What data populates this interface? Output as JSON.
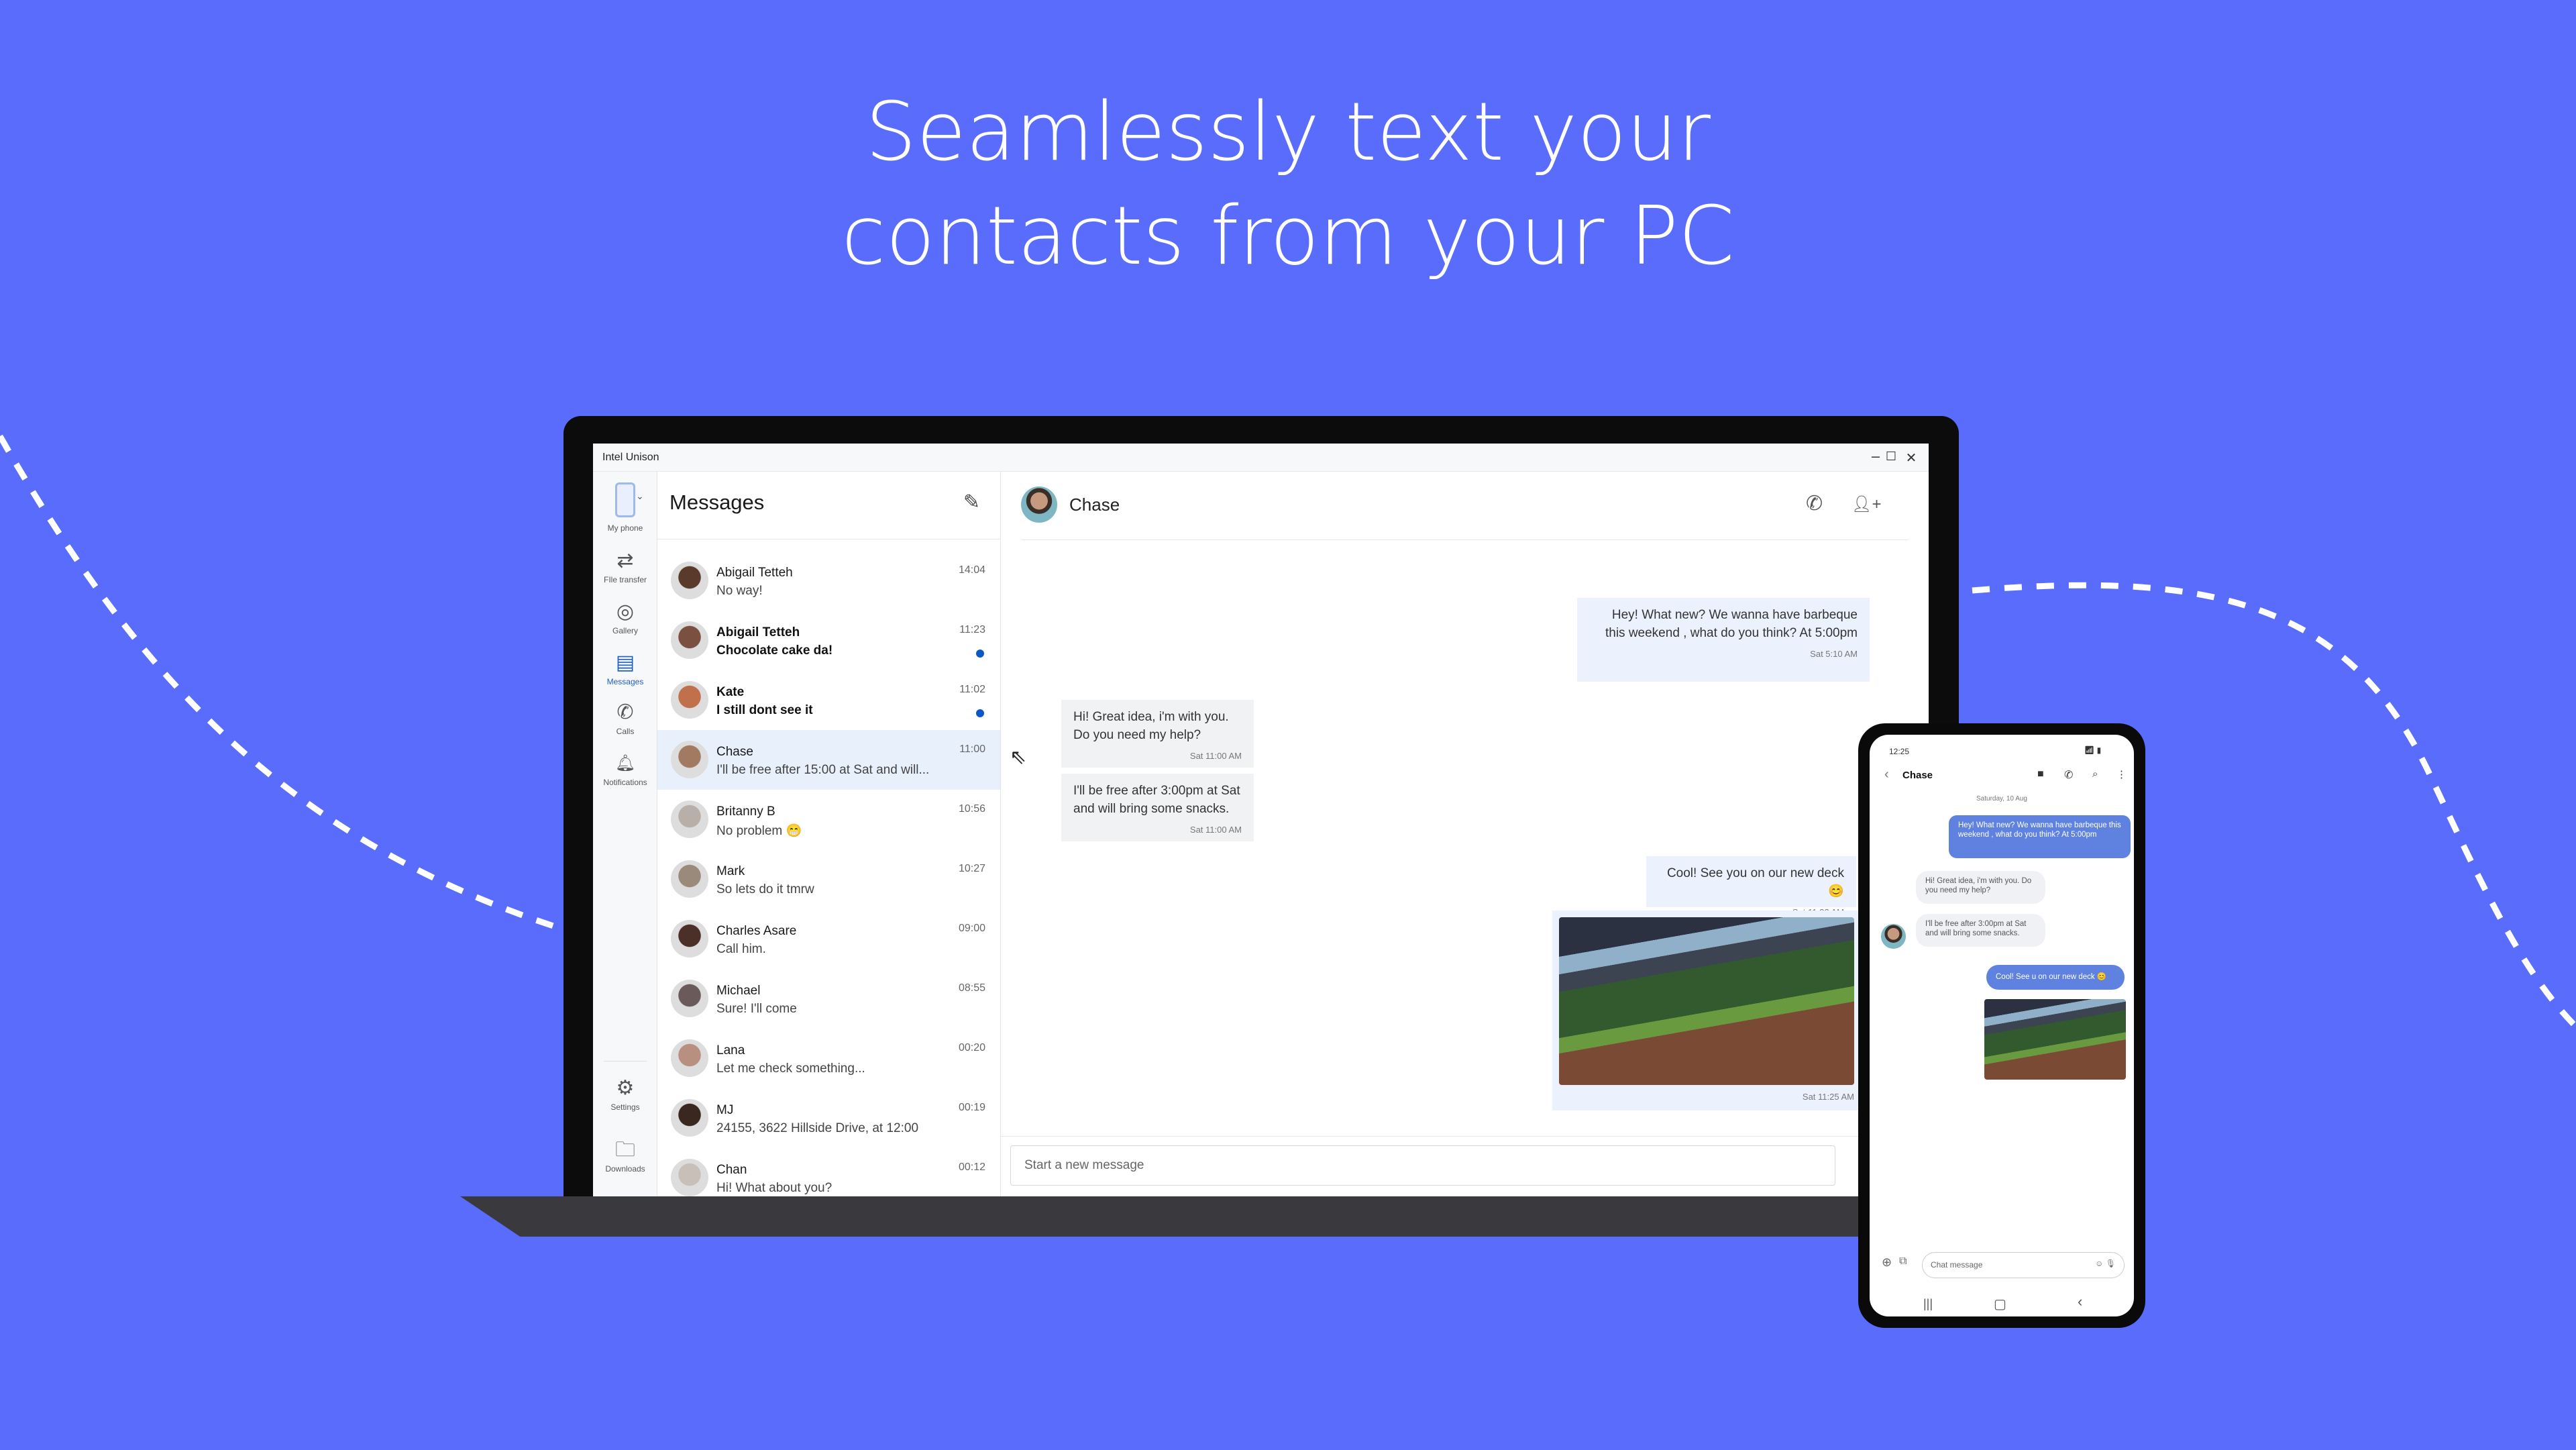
{
  "headline": [
    "Seamlessly text your",
    "contacts from your PC"
  ],
  "colors": {
    "background": "#5a6cfb",
    "accent": "#1f5fc7",
    "unread_dot": "#0b57c7",
    "phone_bubble": "#5f82e0"
  },
  "app": {
    "title": "Intel Unison",
    "window_controls": {
      "minimize": "–",
      "maximize": "☐",
      "close": "✕"
    },
    "sidebar": [
      {
        "label": "My phone",
        "icon": "phone-icon"
      },
      {
        "label": "FIle transfer",
        "icon": "transfer-icon",
        "glyph": "⇄"
      },
      {
        "label": "Gallery",
        "icon": "aperture-icon",
        "glyph": "◎"
      },
      {
        "label": "Messages",
        "icon": "messages-icon",
        "glyph": "▤",
        "active": true
      },
      {
        "label": "Calls",
        "icon": "phone-call-icon",
        "glyph": "✆"
      },
      {
        "label": "Notifications",
        "icon": "bell-icon",
        "glyph": "🔔︎"
      },
      {
        "label": "Settings",
        "icon": "gear-icon",
        "glyph": "⚙"
      },
      {
        "label": "Downloads",
        "icon": "folder-icon",
        "glyph": "🗀"
      }
    ],
    "list": {
      "title": "Messages",
      "compose_glyph": "✎",
      "contacts": [
        {
          "name": "Abigail Tetteh",
          "preview": "No way!",
          "time": "14:04",
          "unread": false,
          "color": "#5a3a2a"
        },
        {
          "name": "Abigail Tetteh",
          "preview": "Chocolate cake da!",
          "time": "11:23",
          "unread": true,
          "color": "#7a5040"
        },
        {
          "name": "Kate",
          "preview": "I still dont see it",
          "time": "11:02",
          "unread": true,
          "color": "#c0704a"
        },
        {
          "name": "Chase",
          "preview": "I'll be free after 15:00 at Sat and will...",
          "time": "11:00",
          "unread": false,
          "selected": true,
          "color": "#a27a62"
        },
        {
          "name": "Britanny B",
          "preview": "No problem 😁",
          "time": "10:56",
          "unread": false,
          "color": "#b8b0a8"
        },
        {
          "name": "Mark",
          "preview": "So lets do it tmrw",
          "time": "10:27",
          "unread": false,
          "color": "#9a8a7a"
        },
        {
          "name": "Charles Asare",
          "preview": "Call him.",
          "time": "09:00",
          "unread": false,
          "color": "#4a3026"
        },
        {
          "name": "Michael",
          "preview": "Sure! I'll come",
          "time": "08:55",
          "unread": false,
          "color": "#6a5a5a"
        },
        {
          "name": "Lana",
          "preview": "Let me check something...",
          "time": "00:20",
          "unread": false,
          "color": "#b89080"
        },
        {
          "name": "MJ",
          "preview": "24155, 3622 Hillside Drive, at 12:00",
          "time": "00:19",
          "unread": false,
          "color": "#3a2820"
        },
        {
          "name": "Chan",
          "preview": "Hi! What about you?",
          "time": "00:12",
          "unread": false,
          "color": "#c8c0b8"
        }
      ]
    },
    "chat": {
      "contact": "Chase",
      "call_glyph": "✆",
      "add_person_glyph": "👤︎+",
      "messages": [
        {
          "dir": "out",
          "text": "Hey! What new? We wanna have barbeque this weekend , what do you think? At 5:00pm",
          "time": "Sat 5:10 AM"
        },
        {
          "dir": "in",
          "text": "Hi! Great idea, i'm with you. Do you need my help?",
          "time": "Sat 11:00 AM"
        },
        {
          "dir": "in",
          "text": "I'll be free after 3:00pm at Sat and will bring some snacks.",
          "time": "Sat 11:00 AM"
        },
        {
          "dir": "out",
          "text": "Cool! See you on our new deck😊",
          "time": "Sat 11:22 AM"
        },
        {
          "dir": "out",
          "image": "deck-photo",
          "time": "Sat 11:25 AM"
        }
      ],
      "input_placeholder": "Start a new message"
    }
  },
  "phone": {
    "time": "12:25",
    "contact": "Chase",
    "date": "Saturday, 10 Aug",
    "messages": [
      {
        "dir": "out",
        "text": "Hey! What new? We wanna have barbeque this weekend , what do you think? At 5:00pm"
      },
      {
        "dir": "in",
        "text": "Hi! Great idea, i'm with you. Do you need my help?"
      },
      {
        "dir": "in",
        "text": "I'll be free after 3:00pm at Sat and will bring some snacks."
      },
      {
        "dir": "out",
        "text": "Cool! See u on our new deck 😊"
      }
    ],
    "input_placeholder": "Chat message"
  }
}
